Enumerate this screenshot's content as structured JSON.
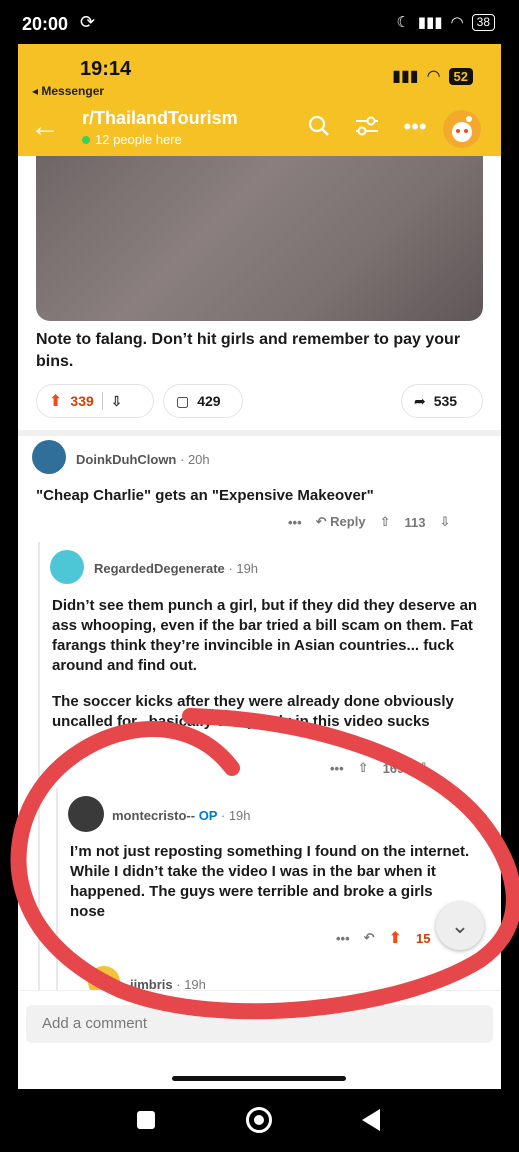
{
  "device_status": {
    "time": "20:00",
    "battery": "38"
  },
  "app_status": {
    "time": "19:14",
    "back_app": "◂ Messenger",
    "battery": "52"
  },
  "header": {
    "subreddit": "r/ThailandTourism",
    "online": "12 people here"
  },
  "post": {
    "text": "Note to falang. Don’t hit girls and remember to pay your bins.",
    "score": "339",
    "comments": "429",
    "shares": "535"
  },
  "comments": [
    {
      "user": "DoinkDuhClown",
      "time": "· 20h",
      "body": "\"Cheap Charlie\" gets an \"Expensive Makeover\"",
      "reply_label": "Reply",
      "score": "113"
    },
    {
      "user": "RegardedDegenerate",
      "time": "· 19h",
      "body_p1": "Didn’t see them punch a girl, but if they did they deserve an ass whooping, even if the bar tried a bill scam on them. Fat farangs think they’re invincible in Asian countries... fuck around and find out.",
      "body_p2": "The soccer kicks after they were already done obviously uncalled for...basically everybody in this video sucks",
      "score": "169"
    },
    {
      "user": "montecristo--",
      "op_badge": "OP",
      "time": "· 19h",
      "body": "I’m not just reposting something I found on the internet. While I didn’t take the video I was in the bar when it happened. The guys were terrible and broke a girls nose",
      "score": "15"
    },
    {
      "user": "jimbris",
      "time": "· 19h"
    }
  ],
  "comment_bar": {
    "placeholder": "Add a comment"
  },
  "colors": {
    "header": "#f5c125",
    "upvote": "#f24a1a",
    "annotation": "#e5474b",
    "op": "#0079d3"
  }
}
